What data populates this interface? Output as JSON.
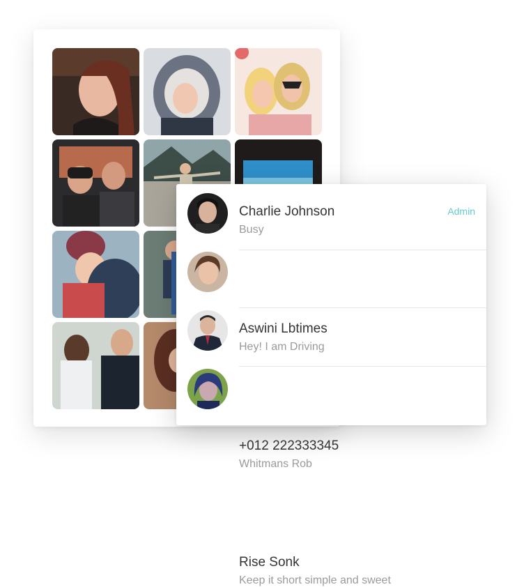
{
  "gallery": {
    "photos": [
      {
        "icon": "woman-portrait-photo"
      },
      {
        "icon": "woman-in-fur-hood-photo"
      },
      {
        "icon": "party-masks-photo"
      },
      {
        "icon": "couple-beanies-photo"
      },
      {
        "icon": "mountain-hikers-photo"
      },
      {
        "icon": "window-view-photo"
      },
      {
        "icon": "mother-child-photo"
      },
      {
        "icon": "backpacker-photo"
      },
      {
        "icon": "empty-tile"
      },
      {
        "icon": "wedding-couple-photo"
      },
      {
        "icon": "woman-hair-photo"
      },
      {
        "icon": "empty-tile"
      }
    ]
  },
  "contacts": [
    {
      "name": "Charlie Johnson",
      "status": "Busy",
      "role": "Admin"
    },
    {
      "name": "Aswini Lbtimes",
      "status": "Hey! I am Driving"
    },
    {
      "name": "+012 222333345",
      "status": "Whitmans Rob"
    },
    {
      "name": "Rise Sonk",
      "status": "Keep it short simple and sweet"
    }
  ],
  "colors": {
    "accent": "#66cccc",
    "name_text": "#333333",
    "status_text": "#9a9a9a"
  }
}
